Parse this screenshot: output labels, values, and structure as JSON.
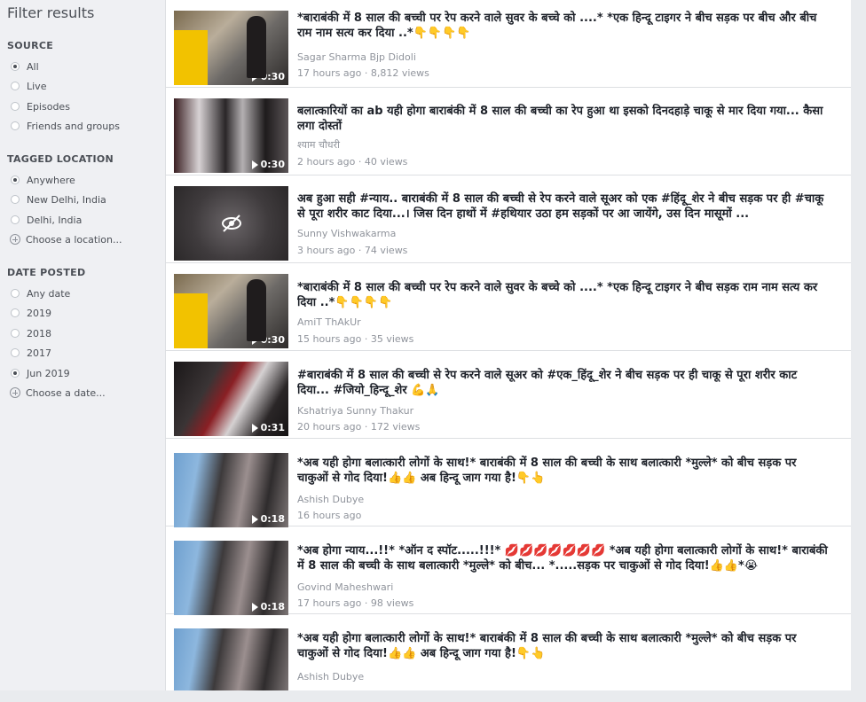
{
  "sidebar": {
    "title": "Filter results",
    "sections": [
      {
        "heading": "SOURCE",
        "options": [
          {
            "label": "All",
            "selected": true
          },
          {
            "label": "Live",
            "selected": false
          },
          {
            "label": "Episodes",
            "selected": false
          },
          {
            "label": "Friends and groups",
            "selected": false
          }
        ]
      },
      {
        "heading": "TAGGED LOCATION",
        "options": [
          {
            "label": "Anywhere",
            "selected": true
          },
          {
            "label": "New Delhi, India",
            "selected": false
          },
          {
            "label": "Delhi, India",
            "selected": false
          }
        ],
        "choose_label": "Choose a location..."
      },
      {
        "heading": "DATE POSTED",
        "options": [
          {
            "label": "Any date",
            "selected": false
          },
          {
            "label": "2019",
            "selected": false
          },
          {
            "label": "2018",
            "selected": false
          },
          {
            "label": "2017",
            "selected": false
          },
          {
            "label": "Jun 2019",
            "selected": true
          }
        ],
        "choose_label": "Choose a date..."
      }
    ]
  },
  "results": [
    {
      "title": "*बाराबंकी में 8 साल की बच्ची पर रेप करने वाले सुवर के बच्चे को ....* *एक हिन्दू टाइगर ने बीच सड़क पर बीच और बीच राम नाम सत्य कर दिया ..*👇👇👇👇",
      "author": "Sagar Sharma Bjp Didoli",
      "meta": "17 hours ago · 8,812 views",
      "duration": "0:30",
      "thumb": "street"
    },
    {
      "title": "बलात्कारियों का ab यही होगा बाराबंकी में 8 साल की बच्ची का रेप हुआ था इसको दिनदहाड़े चाकू से मार दिया गया... कैसा लगा दोस्तों",
      "author": "श्याम चौधरी",
      "meta": "2 hours ago · 40 views",
      "duration": "0:30",
      "thumb": "dark"
    },
    {
      "title": "अब हुआ सही #न्याय.. बाराबंकी में 8 साल की बच्ची से रेप करने वाले सूअर को एक #हिंदू_शेर ने बीच सड़क पर ही #चाकू से पूरा शरीर काट दिया...। जिस दिन हाथों में #हथियार उठा हम सड़कों पर आ जायेंगे, उस दिन मासूमों ...",
      "author": "Sunny Vishwakarma",
      "meta": "3 hours ago · 74 views",
      "duration": "",
      "thumb": "hidden"
    },
    {
      "title": "*बाराबंकी में 8 साल की बच्ची पर रेप करने वाले सुवर के बच्चे को ....* *एक हिन्दू टाइगर ने बीच सड़क राम नाम सत्य कर दिया ..*👇👇👇👇",
      "author": "AmiT ThAkUr",
      "meta": "15 hours ago · 35 views",
      "duration": "0:30",
      "thumb": "street"
    },
    {
      "title": "#बाराबंकी में 8 साल की बच्ची से रेप करने वाले सूअर को #एक_हिंदू_शेर ने बीच सड़क पर ही चाकू से पूरा शरीर काट दिया... #जियो_हिन्दू_शेर 💪🙏",
      "author": "Kshatriya Sunny Thakur",
      "meta": "20 hours ago · 172 views",
      "duration": "0:31",
      "thumb": "red"
    },
    {
      "title": "*अब यही होगा बलात्कारी लोगों के साथ!* बाराबंकी में 8 साल की बच्ची के साथ बलात्कारी *मुल्ले* को बीच सड़क पर चाकुओं से गोद दिया!👍👍 अब हिन्दू जाग गया है!👇👆",
      "author": "Ashish Dubye",
      "meta": "16 hours ago",
      "duration": "0:18",
      "thumb": "blue"
    },
    {
      "title": "*अब होगा न्याय...!!* *ऑन द स्पॉट.....!!!* 💋💋💋💋💋💋💋 *अब यही होगा बलात्कारी लोगों के साथ!* बाराबंकी में 8 साल की बच्ची के साथ बलात्कारी *मुल्ले* को बीच... *.....सड़क पर चाकुओं से गोद दिया!👍👍*😭",
      "author": "Govind Maheshwari",
      "meta": "17 hours ago · 98 views",
      "duration": "0:18",
      "thumb": "blue"
    },
    {
      "title": "*अब यही होगा बलात्कारी लोगों के साथ!* बाराबंकी में 8 साल की बच्ची के साथ बलात्कारी *मुल्ले* को बीच सड़क पर चाकुओं से गोद दिया!👍👍 अब हिन्दू जाग गया है!👇👆",
      "author": "Ashish Dubye",
      "meta": "",
      "duration": "",
      "thumb": "blue"
    }
  ]
}
